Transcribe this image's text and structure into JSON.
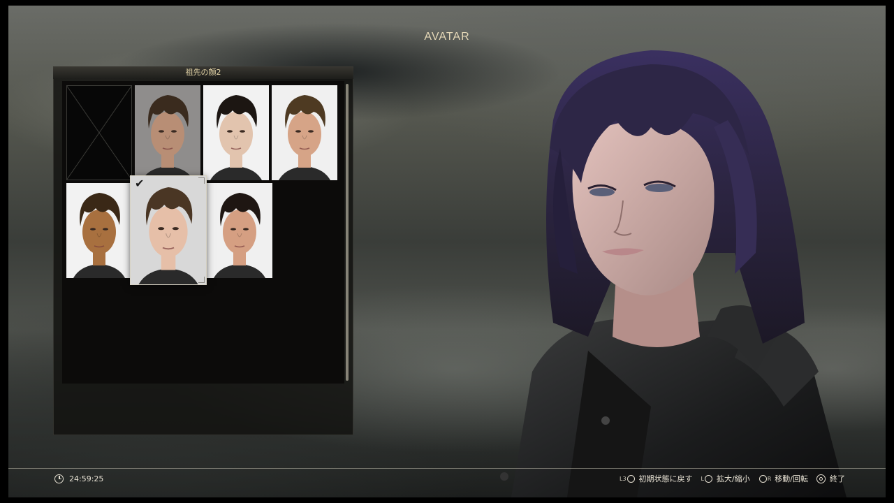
{
  "screen_title": "AVATAR",
  "panel": {
    "header": "祖先の顔2",
    "faces": [
      {
        "id": "empty",
        "skin": "",
        "hair": "",
        "bg": ""
      },
      {
        "id": "face-1",
        "skin": "#b88e75",
        "hair": "#3a2b1e",
        "bg": "#8f8d8c"
      },
      {
        "id": "face-2",
        "skin": "#e2c4ae",
        "hair": "#1c1612",
        "bg": "#f2f2f2"
      },
      {
        "id": "face-3",
        "skin": "#d6a487",
        "hair": "#4e3a22",
        "bg": "#f0f0f0"
      },
      {
        "id": "face-4",
        "skin": "#a8703f",
        "hair": "#3a2816",
        "bg": "#f2f2f2"
      },
      {
        "id": "face-5",
        "skin": "#e6bfa8",
        "hair": "#4a3624",
        "bg": "#d8d8d8"
      },
      {
        "id": "face-6",
        "skin": "#d59f82",
        "hair": "#1e1612",
        "bg": "#f0f0f0"
      }
    ],
    "selected_index": 5,
    "selected_mark": "✔"
  },
  "footer": {
    "time": "24:59:25",
    "hints": [
      {
        "glyph": "L3",
        "label": "初期状態に戻す"
      },
      {
        "glyph": "L",
        "label": "拡大/縮小"
      },
      {
        "glyph": "R",
        "label": "移動/回転"
      },
      {
        "glyph": "",
        "label": "終了"
      }
    ]
  },
  "colors": {
    "accent": "#e6d9b8",
    "character_hair": "#2b2440",
    "character_jacket": "#1e1f20"
  }
}
